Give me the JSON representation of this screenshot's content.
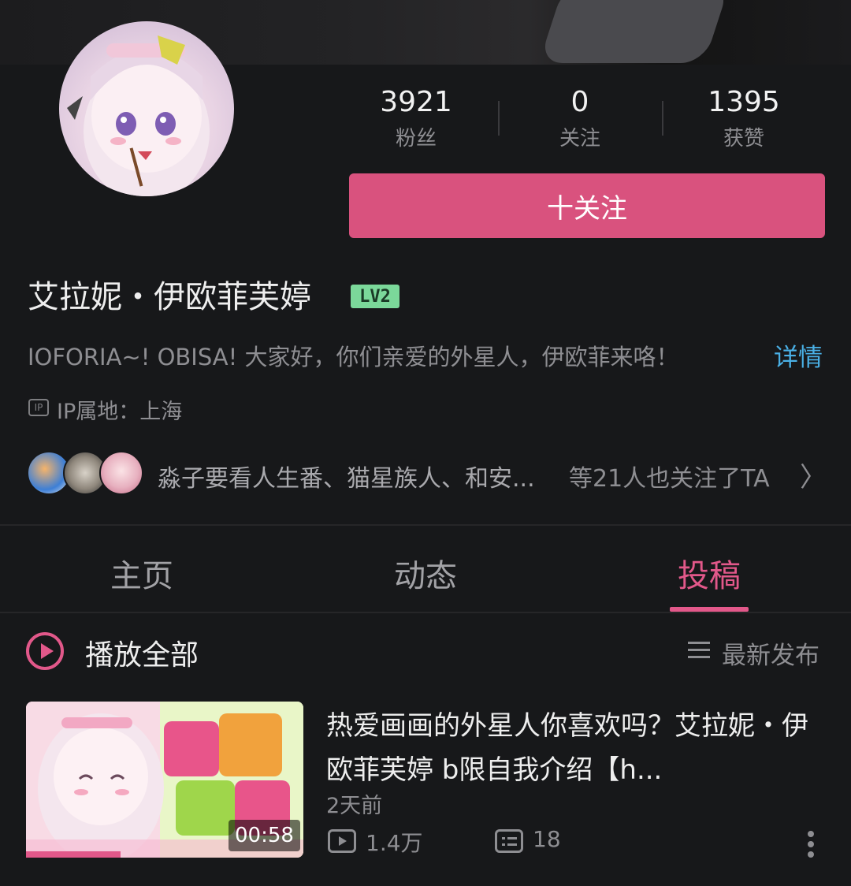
{
  "profile": {
    "name": "艾拉妮・伊欧菲芙婷",
    "level": "LV2",
    "bio": "IOFORIA~! OBISA! 大家好，你们亲爱的外星人，伊欧菲来咯！",
    "detail_label": "详情",
    "ip_badge": "IP",
    "ip_location": "IP属地：上海"
  },
  "stats": [
    {
      "value": "3921",
      "label": "粉丝"
    },
    {
      "value": "0",
      "label": "关注"
    },
    {
      "value": "1395",
      "label": "获赞"
    }
  ],
  "follow_button": "十关注",
  "mutual": {
    "names": "淼子要看人生番、猫星族人、和安...",
    "count_text": "等21人也关注了TA",
    "chevron": "〉"
  },
  "tabs": [
    {
      "label": "主页",
      "active": false
    },
    {
      "label": "动态",
      "active": false
    },
    {
      "label": "投稿",
      "active": true
    }
  ],
  "list_header": {
    "play_all": "播放全部",
    "sort_label": "最新发布"
  },
  "videos": [
    {
      "title": "热爱画画的外星人你喜欢吗？艾拉妮・伊欧菲芙婷 b限自我介绍【h...",
      "duration": "00:58",
      "time": "2天前",
      "views": "1.4万",
      "danmaku": "18"
    }
  ],
  "colors": {
    "accent": "#e2588a",
    "button": "#d9527e",
    "link": "#4ab0e6",
    "background": "#17181a"
  }
}
